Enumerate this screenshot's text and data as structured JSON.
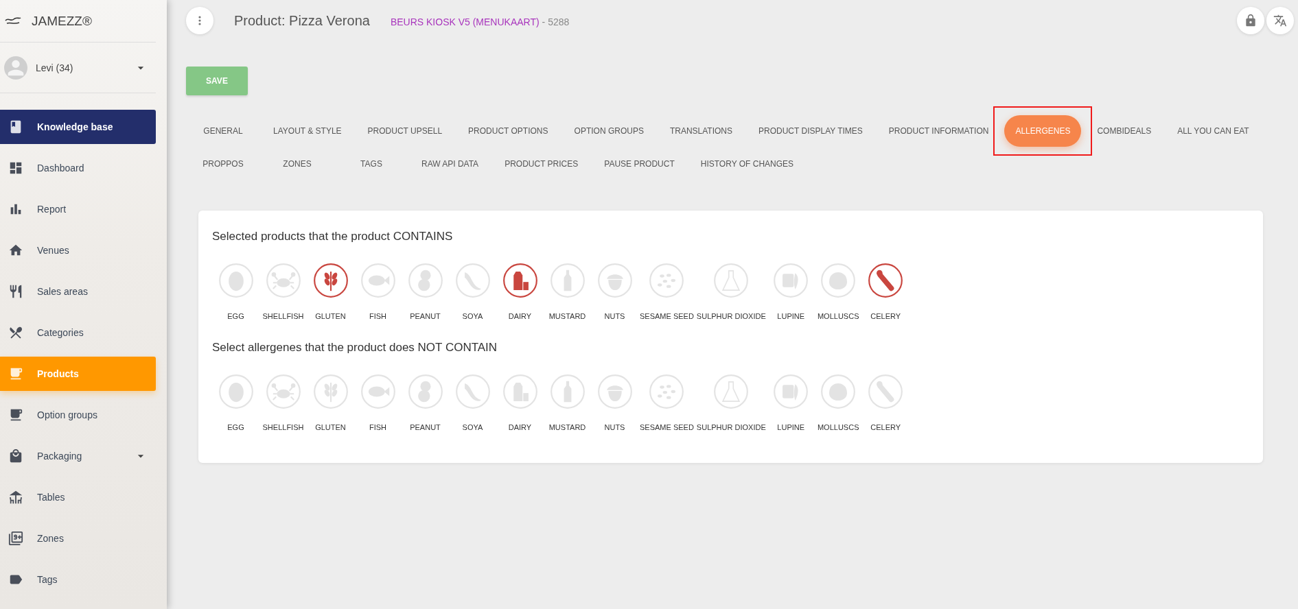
{
  "brand": {
    "name": "JAMEZZ®"
  },
  "user": {
    "name": "Levi (34)"
  },
  "sidebar": {
    "items": [
      {
        "label": "Knowledge base",
        "kind": "featured",
        "selected": false
      },
      {
        "label": "Dashboard",
        "kind": "link",
        "selected": false
      },
      {
        "label": "Report",
        "kind": "link",
        "selected": false
      },
      {
        "label": "Venues",
        "kind": "link",
        "selected": false
      },
      {
        "label": "Sales areas",
        "kind": "link",
        "selected": false
      },
      {
        "label": "Categories",
        "kind": "link",
        "selected": false
      },
      {
        "label": "Products",
        "kind": "link",
        "selected": true
      },
      {
        "label": "Option groups",
        "kind": "link",
        "selected": false
      },
      {
        "label": "Packaging",
        "kind": "expandable",
        "selected": false
      },
      {
        "label": "Tables",
        "kind": "link",
        "selected": false
      },
      {
        "label": "Zones",
        "kind": "link",
        "selected": false
      },
      {
        "label": "Tags",
        "kind": "link",
        "selected": false
      }
    ]
  },
  "header": {
    "title": "Product: Pizza Verona",
    "menu_name": "BEURS KIOSK V5 (MENUKAART)",
    "menu_id": " - 5288"
  },
  "save_button": "SAVE",
  "tabs": [
    [
      {
        "label": "GENERAL",
        "selected": false,
        "highlighted": false
      },
      {
        "label": "LAYOUT & STYLE",
        "selected": false,
        "highlighted": false
      },
      {
        "label": "PRODUCT UPSELL",
        "selected": false,
        "highlighted": false
      },
      {
        "label": "PRODUCT OPTIONS",
        "selected": false,
        "highlighted": false
      },
      {
        "label": "OPTION GROUPS",
        "selected": false,
        "highlighted": false
      },
      {
        "label": "TRANSLATIONS",
        "selected": false,
        "highlighted": false
      },
      {
        "label": "PRODUCT DISPLAY TIMES",
        "selected": false,
        "highlighted": false
      },
      {
        "label": "PRODUCT INFORMATION",
        "selected": false,
        "highlighted": false
      },
      {
        "label": "ALLERGENES",
        "selected": true,
        "highlighted": true
      },
      {
        "label": "COMBIDEALS",
        "selected": false,
        "highlighted": false
      },
      {
        "label": "ALL YOU CAN EAT",
        "selected": false,
        "highlighted": false
      }
    ],
    [
      {
        "label": "PROPPOS",
        "selected": false,
        "highlighted": false
      },
      {
        "label": "ZONES",
        "selected": false,
        "highlighted": false
      },
      {
        "label": "TAGS",
        "selected": false,
        "highlighted": false
      },
      {
        "label": "RAW API DATA",
        "selected": false,
        "highlighted": false
      },
      {
        "label": "PRODUCT PRICES",
        "selected": false,
        "highlighted": false
      },
      {
        "label": "PAUSE PRODUCT",
        "selected": false,
        "highlighted": false
      },
      {
        "label": "HISTORY OF CHANGES",
        "selected": false,
        "highlighted": false
      }
    ]
  ],
  "sections": [
    {
      "title": "Selected products that the product CONTAINS",
      "allergens": [
        {
          "label": "EGG",
          "selected": false
        },
        {
          "label": "SHELLFISH",
          "selected": false
        },
        {
          "label": "GLUTEN",
          "selected": true
        },
        {
          "label": "FISH",
          "selected": false
        },
        {
          "label": "PEANUT",
          "selected": false
        },
        {
          "label": "SOYA",
          "selected": false
        },
        {
          "label": "DAIRY",
          "selected": true
        },
        {
          "label": "MUSTARD",
          "selected": false
        },
        {
          "label": "NUTS",
          "selected": false
        },
        {
          "label": "SESAME SEED",
          "selected": false
        },
        {
          "label": "SULPHUR DIOXIDE",
          "selected": false
        },
        {
          "label": "LUPINE",
          "selected": false
        },
        {
          "label": "MOLLUSCS",
          "selected": false
        },
        {
          "label": "CELERY",
          "selected": true
        }
      ]
    },
    {
      "title": "Select allergenes that the product does NOT CONTAIN",
      "allergens": [
        {
          "label": "EGG",
          "selected": false
        },
        {
          "label": "SHELLFISH",
          "selected": false
        },
        {
          "label": "GLUTEN",
          "selected": false
        },
        {
          "label": "FISH",
          "selected": false
        },
        {
          "label": "PEANUT",
          "selected": false
        },
        {
          "label": "SOYA",
          "selected": false
        },
        {
          "label": "DAIRY",
          "selected": false
        },
        {
          "label": "MUSTARD",
          "selected": false
        },
        {
          "label": "NUTS",
          "selected": false
        },
        {
          "label": "SESAME SEED",
          "selected": false
        },
        {
          "label": "SULPHUR DIOXIDE",
          "selected": false
        },
        {
          "label": "LUPINE",
          "selected": false
        },
        {
          "label": "MOLLUSCS",
          "selected": false
        },
        {
          "label": "CELERY",
          "selected": false
        }
      ]
    }
  ]
}
